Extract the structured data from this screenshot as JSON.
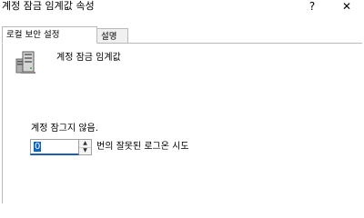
{
  "window": {
    "title": "계정 잠금 임계값 속성",
    "help_label": "?",
    "close_label": "✕"
  },
  "tabs": [
    {
      "label": "로컬 보안 설정",
      "selected": true
    },
    {
      "label": "설명",
      "selected": false
    }
  ],
  "policy": {
    "icon": "server-policy-icon",
    "title": "계정 잠금 임계값"
  },
  "setting": {
    "label": "계정 잠그지 않음.",
    "value": "0",
    "unit_label": "번의 잘못된 로그온 시도"
  },
  "colors": {
    "selection": "#0a64c8",
    "focus_underline": "#1a5fb4",
    "tab_border": "#b9b9b9"
  }
}
